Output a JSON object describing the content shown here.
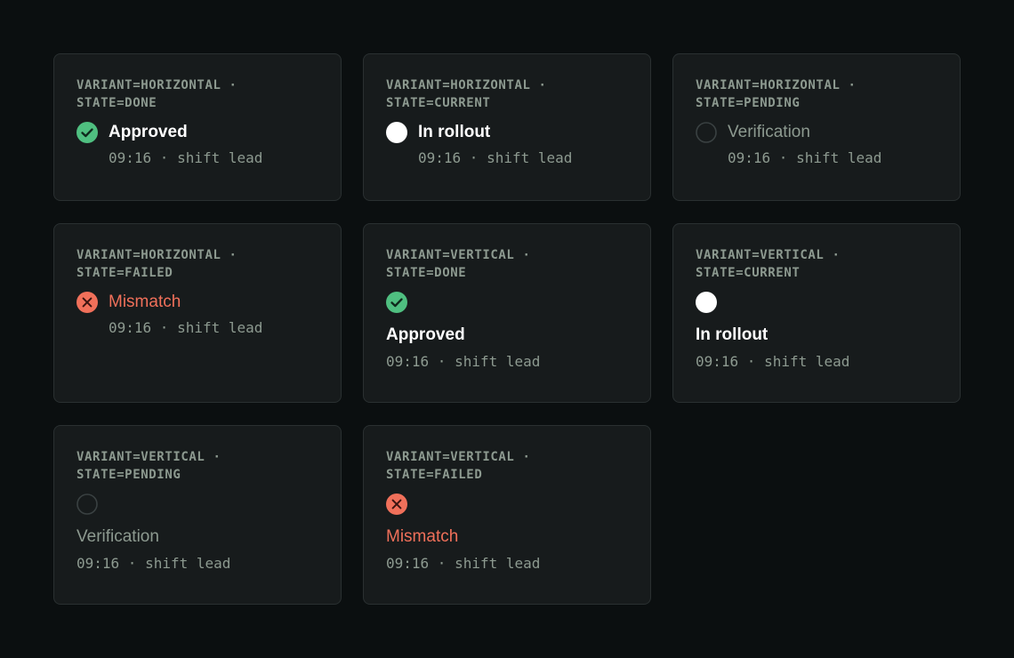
{
  "colors": {
    "background": "#0b0f10",
    "card": "#171b1c",
    "border": "#2a3031",
    "muted": "#8d9a90",
    "done": "#4fbf80",
    "current": "#ffffff",
    "failed": "#f0705a"
  },
  "cards": [
    {
      "caption_line1": "VARIANT=HORIZONTAL ·",
      "caption_line2": "STATE=DONE",
      "icon": "check-circle-icon",
      "label": "Approved",
      "meta": "09:16 · shift lead"
    },
    {
      "caption_line1": "VARIANT=HORIZONTAL ·",
      "caption_line2": "STATE=CURRENT",
      "icon": "filled-circle-icon",
      "label": "In rollout",
      "meta": "09:16 · shift lead"
    },
    {
      "caption_line1": "VARIANT=HORIZONTAL ·",
      "caption_line2": "STATE=PENDING",
      "icon": "empty-circle-icon",
      "label": "Verification",
      "meta": "09:16 · shift lead"
    },
    {
      "caption_line1": "VARIANT=HORIZONTAL ·",
      "caption_line2": "STATE=FAILED",
      "icon": "x-circle-icon",
      "label": "Mismatch",
      "meta": "09:16 · shift lead"
    },
    {
      "caption_line1": "VARIANT=VERTICAL ·",
      "caption_line2": "STATE=DONE",
      "icon": "check-circle-icon",
      "label": "Approved",
      "meta": "09:16 · shift lead"
    },
    {
      "caption_line1": "VARIANT=VERTICAL ·",
      "caption_line2": "STATE=CURRENT",
      "icon": "filled-circle-icon",
      "label": "In rollout",
      "meta": "09:16 · shift lead"
    },
    {
      "caption_line1": "VARIANT=VERTICAL ·",
      "caption_line2": "STATE=PENDING",
      "icon": "empty-circle-icon",
      "label": "Verification",
      "meta": "09:16 · shift lead"
    },
    {
      "caption_line1": "VARIANT=VERTICAL ·",
      "caption_line2": "STATE=FAILED",
      "icon": "x-circle-icon",
      "label": "Mismatch",
      "meta": "09:16 · shift lead"
    }
  ]
}
